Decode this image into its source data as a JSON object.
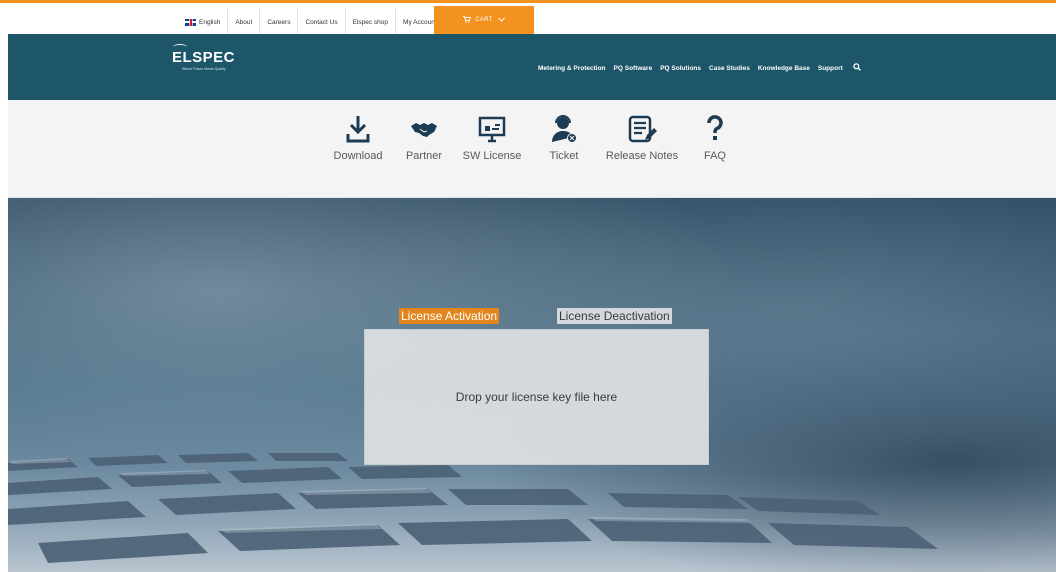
{
  "topbar": {
    "language": "English",
    "links": [
      "About",
      "Careers",
      "Contact Us",
      "Elspec shop",
      "My Account"
    ],
    "cart_label": "CART"
  },
  "header": {
    "logo_text": "ELSPEC",
    "logo_tagline": "Where Power Meets Quality",
    "nav": [
      "Metering & Protection",
      "PQ Software",
      "PQ Solutions",
      "Case Studies",
      "Knowledge Base",
      "Support"
    ]
  },
  "shortcuts": [
    {
      "label": "Download",
      "icon": "download-icon"
    },
    {
      "label": "Partner",
      "icon": "handshake-icon"
    },
    {
      "label": "SW License",
      "icon": "monitor-license-icon"
    },
    {
      "label": "Ticket",
      "icon": "support-agent-icon"
    },
    {
      "label": "Release Notes",
      "icon": "notes-edit-icon"
    },
    {
      "label": "FAQ",
      "icon": "question-icon"
    }
  ],
  "license": {
    "tab_activation": "License Activation",
    "tab_deactivation": "License Deactivation",
    "drop_text": "Drop your license key file here"
  },
  "colors": {
    "accent": "#f39220",
    "header_bg": "#1d5668",
    "tab_active": "#e1861e",
    "icon_color": "#1d3c54"
  }
}
